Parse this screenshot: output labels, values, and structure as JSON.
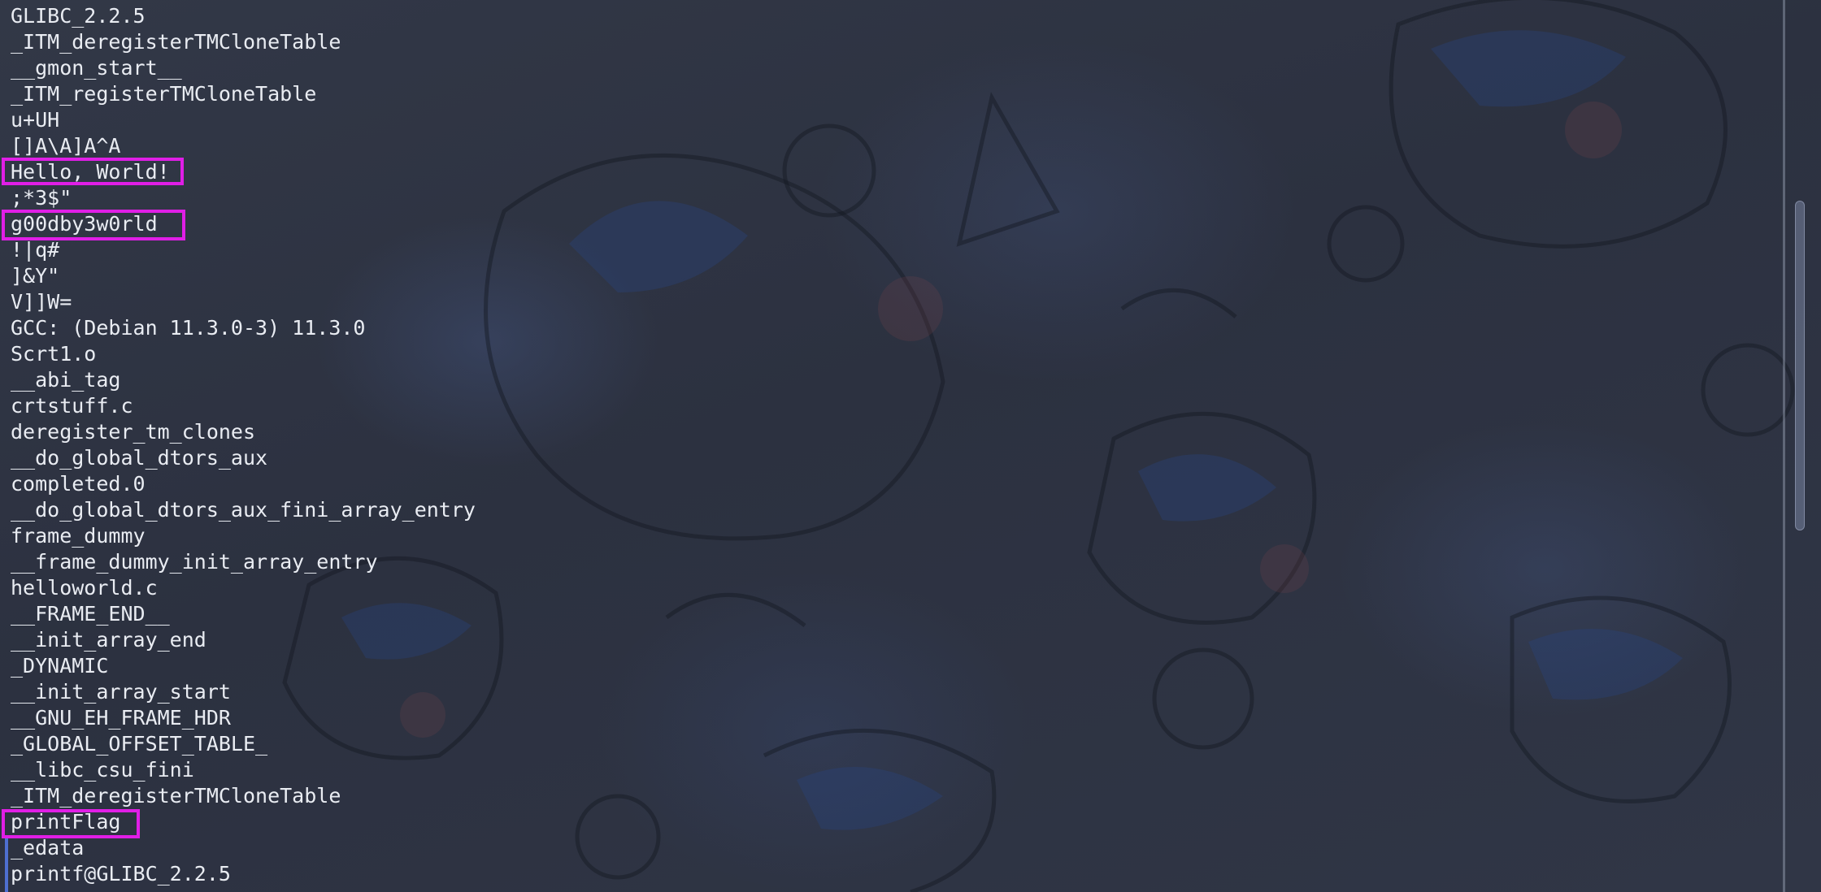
{
  "terminal": {
    "lines": [
      "GLIBC_2.2.5",
      "_ITM_deregisterTMCloneTable",
      "__gmon_start__",
      "_ITM_registerTMCloneTable",
      "u+UH",
      "[]A\\A]A^A",
      "Hello, World!",
      ";*3$\"",
      "g00dby3w0rld",
      "!|q#",
      "]&Y\"",
      "V]]W=",
      "GCC: (Debian 11.3.0-3) 11.3.0",
      "Scrt1.o",
      "__abi_tag",
      "crtstuff.c",
      "deregister_tm_clones",
      "__do_global_dtors_aux",
      "completed.0",
      "__do_global_dtors_aux_fini_array_entry",
      "frame_dummy",
      "__frame_dummy_init_array_entry",
      "helloworld.c",
      "__FRAME_END__",
      "__init_array_end",
      "_DYNAMIC",
      "__init_array_start",
      "__GNU_EH_FRAME_HDR",
      "_GLOBAL_OFFSET_TABLE_",
      "__libc_csu_fini",
      "_ITM_deregisterTMCloneTable",
      "printFlag",
      "_edata",
      "printf@GLIBC_2.2.5"
    ]
  },
  "colors": {
    "highlight_border": "#e01ee6",
    "text": "#e9ecf2",
    "background": "#2b3040",
    "marker": "#4e6fd0"
  }
}
